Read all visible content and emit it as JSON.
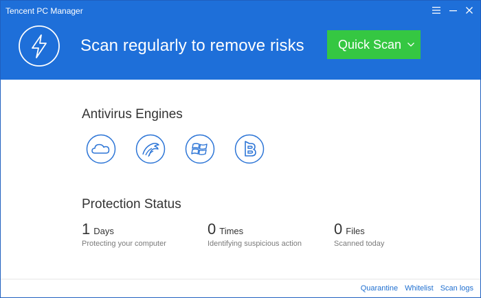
{
  "window": {
    "title": "Tencent PC Manager"
  },
  "header": {
    "headline": "Scan regularly to remove risks",
    "scan_button_label": "Quick Scan",
    "bg_color": "#1e6fd9",
    "button_color": "#35c742"
  },
  "engines": {
    "title": "Antivirus Engines",
    "items": [
      {
        "icon": "cloud-icon"
      },
      {
        "icon": "eagle-icon"
      },
      {
        "icon": "windows-icon"
      },
      {
        "icon": "bitdefender-b-icon"
      }
    ]
  },
  "protection": {
    "title": "Protection Status",
    "stats": [
      {
        "value": "1",
        "unit": "Days",
        "desc": "Protecting your computer"
      },
      {
        "value": "0",
        "unit": "Times",
        "desc": "Identifying suspicious action"
      },
      {
        "value": "0",
        "unit": "Files",
        "desc": "Scanned today"
      }
    ]
  },
  "footer": {
    "links": [
      "Quarantine",
      "Whitelist",
      "Scan logs"
    ]
  }
}
